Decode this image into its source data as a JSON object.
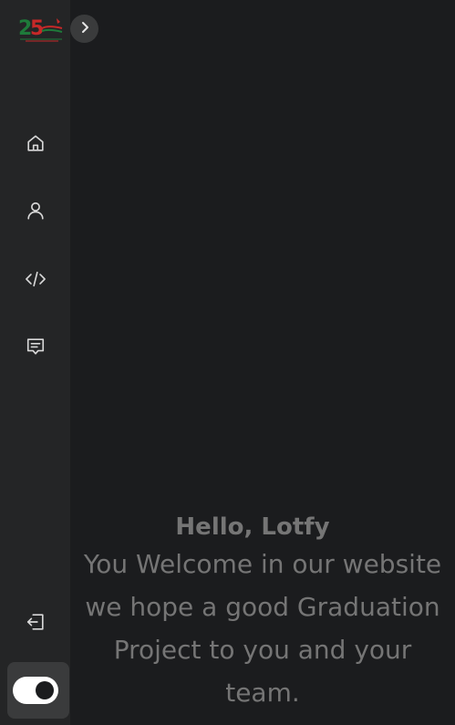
{
  "sidebar": {
    "logo_text": "25",
    "toggle_icon": "chevron-right-icon",
    "items": [
      {
        "label": "Home",
        "icon": "home-icon"
      },
      {
        "label": "Profile",
        "icon": "user-icon"
      },
      {
        "label": "Projects",
        "icon": "code-icon"
      },
      {
        "label": "Messages",
        "icon": "message-icon"
      }
    ],
    "logout": {
      "label": "Logout",
      "icon": "logout-icon"
    },
    "theme_toggle": {
      "state": "dark",
      "icon": "toggle-icon"
    }
  },
  "main": {
    "greeting": "Hello, Lotfy",
    "welcome_text": "You Welcome in our website we hope a good Graduation Project to you and your team."
  },
  "colors": {
    "background": "#1b1c1e",
    "sidebar": "#242526",
    "text_muted": "#757575",
    "icon": "#d8d8d8"
  }
}
